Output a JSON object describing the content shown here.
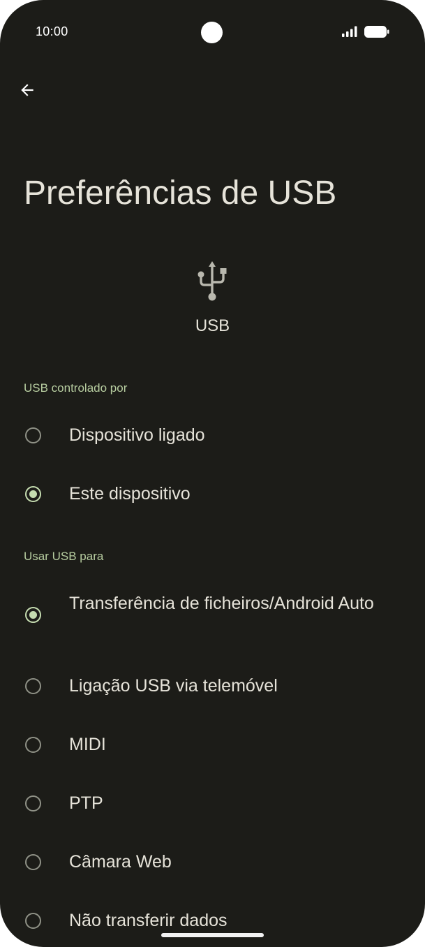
{
  "status_bar": {
    "time": "10:00"
  },
  "header": {
    "back_icon": "arrow-back-icon",
    "title": "Preferências de USB"
  },
  "hero": {
    "icon": "usb-icon",
    "label": "USB"
  },
  "sections": [
    {
      "header": "USB controlado por",
      "options": [
        {
          "label": "Dispositivo ligado",
          "selected": false
        },
        {
          "label": "Este dispositivo",
          "selected": true
        }
      ]
    },
    {
      "header": "Usar USB para",
      "options": [
        {
          "label": "Transferência de ficheiros/Android Auto",
          "selected": true
        },
        {
          "label": "Ligação USB via telemóvel",
          "selected": false
        },
        {
          "label": "MIDI",
          "selected": false
        },
        {
          "label": "PTP",
          "selected": false
        },
        {
          "label": "Câmara Web",
          "selected": false
        },
        {
          "label": "Não transferir dados",
          "selected": false
        }
      ]
    }
  ],
  "colors": {
    "background": "#1c1c18",
    "text": "#e6e3d9",
    "accent": "#c5dcb0",
    "section_header": "#b7cda0",
    "radio_unchecked": "#8f9186"
  }
}
